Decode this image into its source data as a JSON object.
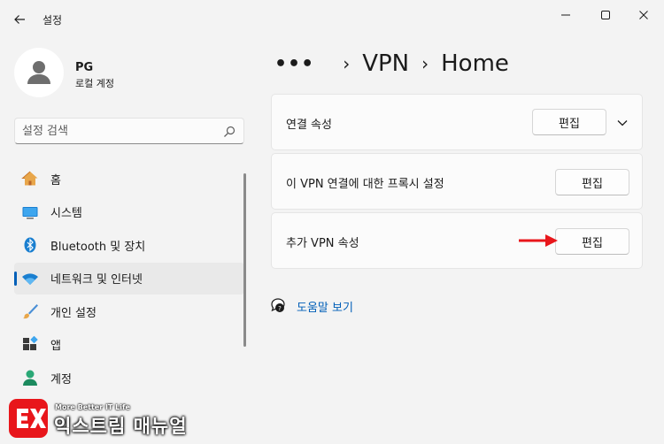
{
  "window": {
    "app_title": "설정"
  },
  "profile": {
    "name": "PG",
    "account_type": "로컬 계정"
  },
  "search": {
    "placeholder": "설정 검색"
  },
  "nav": {
    "items": [
      {
        "label": "홈",
        "icon": "home-icon"
      },
      {
        "label": "시스템",
        "icon": "monitor-icon"
      },
      {
        "label": "Bluetooth 및 장치",
        "icon": "bluetooth-icon"
      },
      {
        "label": "네트워크 및 인터넷",
        "icon": "wifi-icon",
        "active": true
      },
      {
        "label": "개인 설정",
        "icon": "brush-icon"
      },
      {
        "label": "앱",
        "icon": "apps-icon"
      },
      {
        "label": "계정",
        "icon": "person-icon"
      }
    ]
  },
  "breadcrumb": {
    "dots": "•••",
    "items": [
      "VPN",
      "Home"
    ]
  },
  "cards": [
    {
      "label": "연결 속성",
      "button": "편집"
    },
    {
      "label": "이 VPN 연결에 대한 프록시 설정",
      "button": "편집"
    },
    {
      "label": "추가 VPN 속성",
      "button": "편집"
    }
  ],
  "help": {
    "label": "도움말 보기"
  },
  "watermark": {
    "tagline": "More Better IT Life",
    "name": "익스트림 매뉴얼"
  },
  "colors": {
    "accent": "#005fb8",
    "arrow": "#e8161b",
    "logo": "#e8161b"
  }
}
